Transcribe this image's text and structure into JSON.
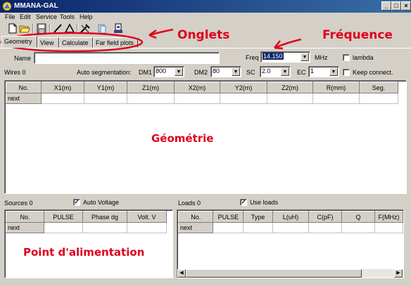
{
  "window": {
    "title": "MMANA-GAL"
  },
  "menu": [
    "File",
    "Edit",
    "Service",
    "Tools",
    "Help"
  ],
  "tabs": [
    "Geometry",
    "View",
    "Calculate",
    "Far field plots"
  ],
  "geometry": {
    "name_label": "Name",
    "name_value": "",
    "freq_label": "Freq",
    "freq_value": "14.150",
    "freq_unit": "MHz",
    "lambda_label": "lambda",
    "wires_label": "Wires 0",
    "autoseg_label": "Auto segmentation:",
    "dm1_label": "DM1",
    "dm1_value": "800",
    "dm2_label": "DM2",
    "dm2_value": "80",
    "sc_label": "SC",
    "sc_value": "2.0",
    "ec_label": "EC",
    "ec_value": "1",
    "keep_label": "Keep connect.",
    "columns": [
      "No.",
      "X1(m)",
      "Y1(m)",
      "Z1(m)",
      "X2(m)",
      "Y2(m)",
      "Z2(m)",
      "R(mm)",
      "Seg."
    ],
    "row_label": "next"
  },
  "sources": {
    "label": "Sources 0",
    "auto_voltage_label": "Auto Voltage",
    "auto_voltage_checked": true,
    "columns": [
      "No.",
      "PULSE",
      "Phase dg",
      "Volt. V"
    ],
    "row_label": "next"
  },
  "loads": {
    "label": "Loads 0",
    "use_loads_label": "Use loads",
    "use_loads_checked": true,
    "columns": [
      "No.",
      "PULSE",
      "Type",
      "L(uH)",
      "C(pF)",
      "Q",
      "F(MHz)"
    ],
    "row_label": "next"
  },
  "annotations": {
    "onglets": "Onglets",
    "frequence": "Fréquence",
    "geometrie": "Géométrie",
    "alimentation": "Point d'alimentation",
    "color": "#e0001b"
  },
  "icons": [
    "new-file-icon",
    "open-folder-icon",
    "save-icon",
    "line-icon",
    "triangle-icon",
    "tools-icon",
    "copy-icon",
    "export-icon"
  ]
}
